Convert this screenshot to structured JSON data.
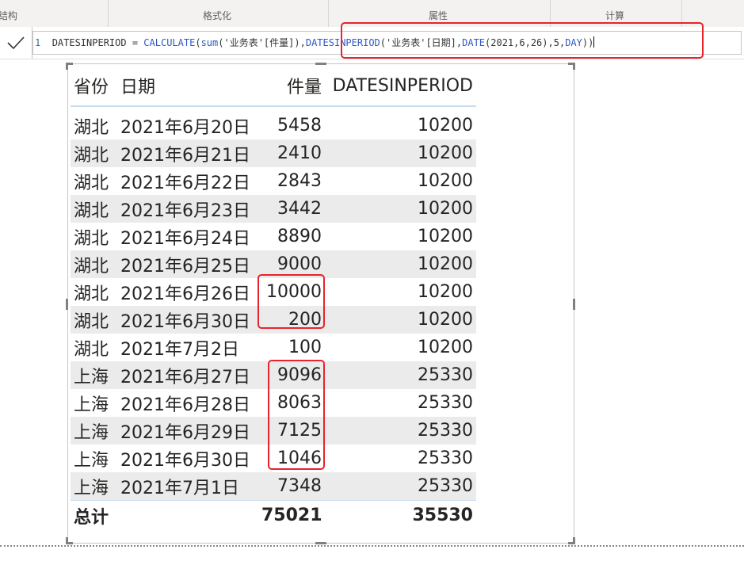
{
  "ribbon": {
    "groups": [
      "结构",
      "格式化",
      "属性",
      "计算"
    ]
  },
  "formula": {
    "line_number": "1",
    "measure_name": "DATESINPERIOD",
    "text_before": " = ",
    "fn_calculate": "CALCULATE",
    "open_paren": "(",
    "fn_sum": "sum",
    "sum_arg": "('业务表'[件量])",
    "comma": ",",
    "fn_datesinperiod": "DATESINPERIOD",
    "dip_arg_open": "('业务表'[日期],",
    "fn_date": "DATE",
    "date_args": "(2021,6,26),5,",
    "fn_day": "DAY",
    "close": "))"
  },
  "table": {
    "headers": {
      "province": "省份",
      "date": "日期",
      "qty": "件量",
      "dp": "DATESINPERIOD"
    },
    "rows": [
      {
        "province": "湖北",
        "date": "2021年6月20日",
        "qty": "5458",
        "dp": "10200"
      },
      {
        "province": "湖北",
        "date": "2021年6月21日",
        "qty": "2410",
        "dp": "10200"
      },
      {
        "province": "湖北",
        "date": "2021年6月22日",
        "qty": "2843",
        "dp": "10200"
      },
      {
        "province": "湖北",
        "date": "2021年6月23日",
        "qty": "3442",
        "dp": "10200"
      },
      {
        "province": "湖北",
        "date": "2021年6月24日",
        "qty": "8890",
        "dp": "10200"
      },
      {
        "province": "湖北",
        "date": "2021年6月25日",
        "qty": "9000",
        "dp": "10200"
      },
      {
        "province": "湖北",
        "date": "2021年6月26日",
        "qty": "10000",
        "dp": "10200"
      },
      {
        "province": "湖北",
        "date": "2021年6月30日",
        "qty": "200",
        "dp": "10200"
      },
      {
        "province": "湖北",
        "date": "2021年7月2日",
        "qty": "100",
        "dp": "10200"
      },
      {
        "province": "上海",
        "date": "2021年6月27日",
        "qty": "9096",
        "dp": "25330"
      },
      {
        "province": "上海",
        "date": "2021年6月28日",
        "qty": "8063",
        "dp": "25330"
      },
      {
        "province": "上海",
        "date": "2021年6月29日",
        "qty": "7125",
        "dp": "25330"
      },
      {
        "province": "上海",
        "date": "2021年6月30日",
        "qty": "1046",
        "dp": "25330"
      },
      {
        "province": "上海",
        "date": "2021年7月1日",
        "qty": "7348",
        "dp": "25330"
      }
    ],
    "total": {
      "label": "总计",
      "qty": "75021",
      "dp": "35530"
    }
  },
  "colors": {
    "annotation_red": "#e8232b",
    "keyword_blue": "#2d58c8",
    "row_stripe": "#ebebeb",
    "header_rule": "#c7dcef"
  },
  "icons": {
    "commit": "checkmark-icon"
  }
}
